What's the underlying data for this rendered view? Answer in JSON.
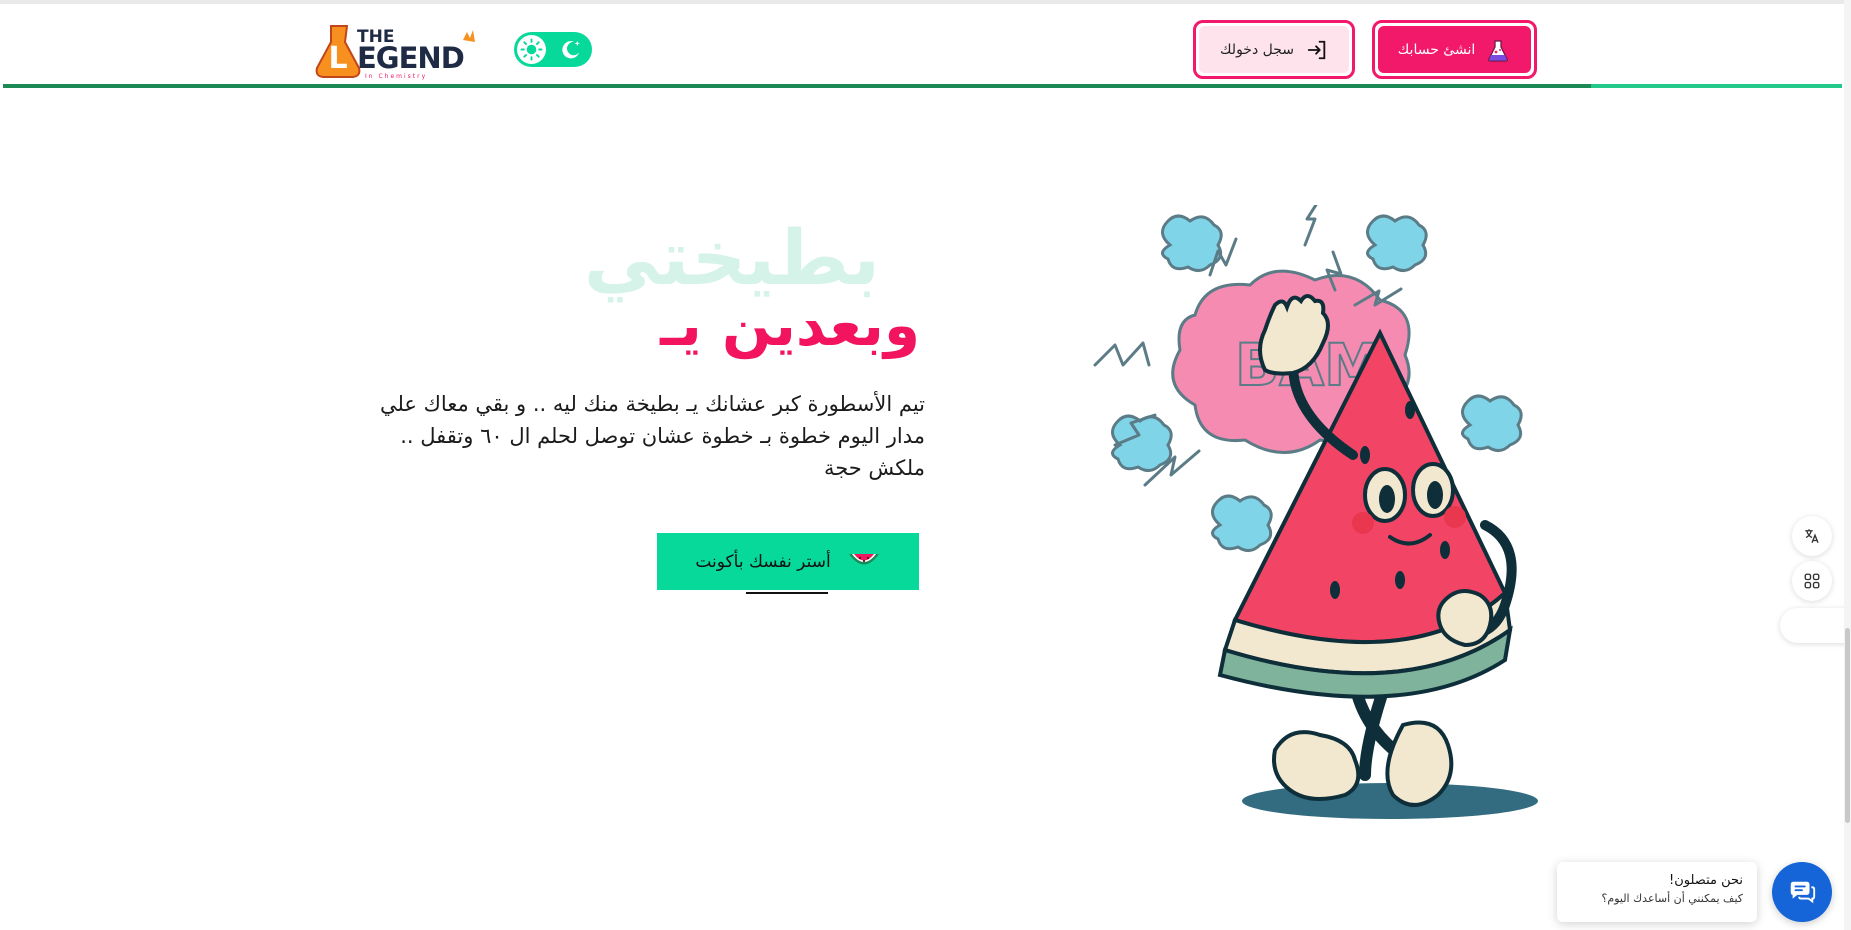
{
  "header": {
    "register_label": "انشئ حسابك",
    "login_label": "سجل دخولك",
    "logo": {
      "line1": "THE",
      "line2": "EGEND",
      "initial": "L",
      "tagline": "In Chemistry"
    }
  },
  "hero": {
    "outline_word": "بطيختي",
    "title": "وبعدين يـ",
    "text": "تيم الأسطورة كبر عشانك يـ بطيخة منك ليه .. و بقي معاك علي مدار اليوم خطوة بـ خطوة عشان توصل لحلم ال ٦٠ وتقفل .. ملكش حجة",
    "cta_label": "أستر نفسك بأكونت"
  },
  "mascot": {
    "text": "BAM"
  },
  "chat": {
    "title": "نحن متصلون!",
    "subtitle": "كيف يمكنني أن أساعدك اليوم؟"
  },
  "colors": {
    "primary": "#f2186a",
    "accent": "#07d99a",
    "header_border": "#1b8a55",
    "chat": "#1565d8"
  },
  "icons": {
    "register": "flask-icon",
    "login": "login-arrow-icon",
    "cta": "watermelon-icon",
    "theme_light": "sun-icon",
    "theme_dark": "moon-icon",
    "side_translate": "translate-icon",
    "side_apps": "apps-grid-icon",
    "chat": "chat-icon"
  }
}
